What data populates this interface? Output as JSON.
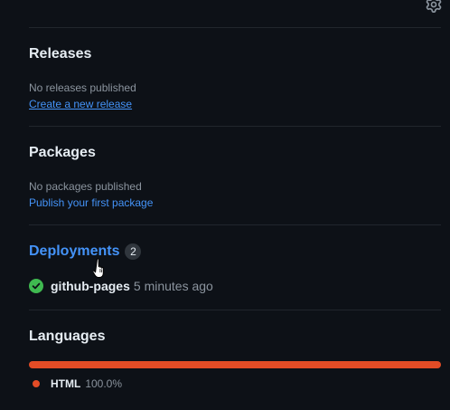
{
  "releases": {
    "title": "Releases",
    "empty_text": "No releases published",
    "link": "Create a new release"
  },
  "packages": {
    "title": "Packages",
    "empty_text": "No packages published",
    "link": "Publish your first package"
  },
  "deployments": {
    "title": "Deployments",
    "count": "2",
    "items": [
      {
        "environment": "github-pages",
        "time": "5 minutes ago",
        "status": "success"
      }
    ]
  },
  "languages": {
    "title": "Languages",
    "items": [
      {
        "name": "HTML",
        "percent": "100.0%",
        "fraction": 1.0,
        "color": "#e34c26"
      }
    ]
  },
  "icons": {
    "settings": "gear-icon",
    "status": "check-circle-icon",
    "cursor": "hand-pointer-cursor"
  },
  "colors": {
    "background": "#0d1117",
    "link": "#4493f8",
    "success": "#3fb950",
    "html": "#e34c26"
  }
}
